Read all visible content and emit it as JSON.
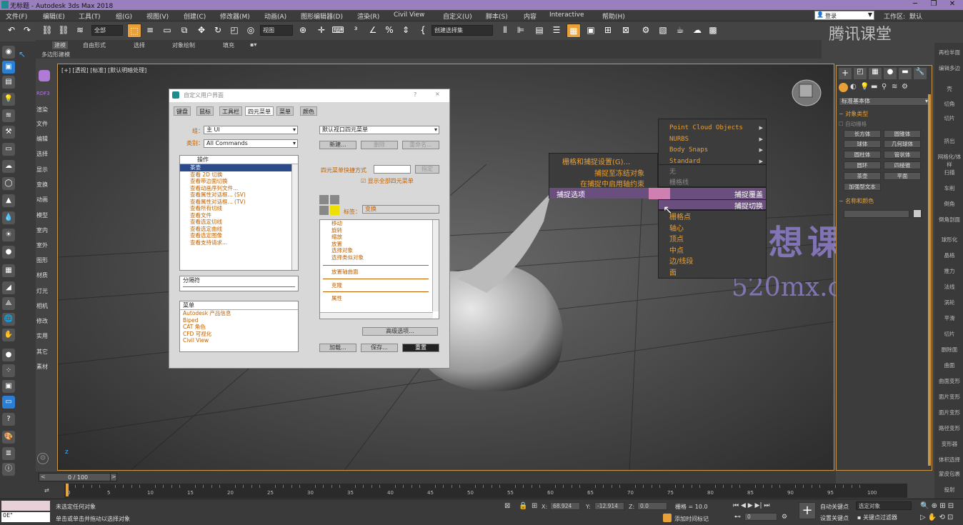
{
  "app": {
    "title": "无标题 - Autodesk 3ds Max 2018"
  },
  "menu": [
    "文件(F)",
    "编辑(E)",
    "工具(T)",
    "组(G)",
    "视图(V)",
    "创建(C)",
    "修改器(M)",
    "动画(A)",
    "图形编辑器(D)",
    "渲染(R)",
    "Civil View",
    "自定义(U)",
    "脚本(S)",
    "内容",
    "Interactive",
    "帮助(H)"
  ],
  "login": {
    "user": "登录",
    "workspace_label": "工作区:",
    "workspace": "默认"
  },
  "toolbar": {
    "filter": "全部",
    "refcoord": "视图",
    "selset": "创建选择集"
  },
  "ribbon": {
    "tabs": [
      "建模",
      "自由形式",
      "选择",
      "对象绘制",
      "填充"
    ],
    "sub": "多边形建模"
  },
  "left_labels": [
    "渲染",
    "文件",
    "编辑",
    "选择",
    "显示",
    "变换",
    "动画",
    "模型",
    "室内",
    "室外",
    "图形",
    "材质",
    "灯光",
    "相机",
    "修改",
    "实用",
    "其它",
    "素材"
  ],
  "rdf": "RDF3",
  "viewport": {
    "label": "[+] [透视] [标准] [默认明暗处理]"
  },
  "dialog": {
    "title": "自定义用户界面",
    "help": "?",
    "close": "×",
    "tabs": [
      "键盘",
      "鼠标",
      "工具栏",
      "四元菜单",
      "菜单",
      "颜色"
    ],
    "group_label": "组：",
    "group_value": "主 UI",
    "category_label": "类别：",
    "category_value": "All Commands",
    "actions_header": "操作",
    "actions": [
      "茶壶",
      "查看 2D 切换",
      "查看带边面切换",
      "查看动画序列文件...",
      "查看属性对话框... (SV)",
      "查看属性对话框... (TV)",
      "查看所有切线",
      "查看文件",
      "查看选定切线",
      "查看选定曲线",
      "查看选定图像",
      "查看支持请求..."
    ],
    "separator_label": "分隔符",
    "menu_list_header": "菜单",
    "menu_list": [
      "Autodesk 产品信息",
      "Biped",
      "CAT 角色",
      "CFD 可视化",
      "Civil View"
    ],
    "quad_select": "默认视口四元菜单",
    "btn_new": "新建...",
    "btn_delete": "删除",
    "btn_rename": "重命名...",
    "shortcut_label": "四元菜单快捷方式",
    "shortcut_btn": "指定",
    "show_all": "显示全部四元菜单",
    "tag_label": "标签：",
    "tag_value": "变换",
    "quad_items": [
      "移动",
      "旋转",
      "缩放",
      "放置",
      "选择对象",
      "选择类似对象"
    ],
    "quad_items2": [
      "放置轴曲面",
      "克隆",
      "属性"
    ],
    "btn_advanced": "高级选项...",
    "btn_load": "加载...",
    "btn_save": "保存...",
    "btn_reset": "重置"
  },
  "quad": {
    "left": [
      "栅格和捕捉设置(G)...",
      "捕捉至冻结对象",
      "在捕捉中启用轴约束",
      "捕捉选项"
    ],
    "right_top": [
      "Point Cloud Objects",
      "NURBS",
      "Body Snaps",
      "Standard"
    ],
    "right_mid": [
      "无",
      "栅格线"
    ],
    "hl1": "捕捉覆盖",
    "hl2": "捕捉切换",
    "right_bottom": [
      "栅格点",
      "轴心",
      "顶点",
      "中点",
      "边/线段",
      "面"
    ]
  },
  "watermarks": {
    "tencent": "腾讯课堂",
    "mengxiang": "梦想课堂",
    "url": "520mx.com"
  },
  "rightpanel": {
    "dropdown": "标准基本体",
    "objtype": "对象类型",
    "autogrid": "自动栅格",
    "buttons": [
      "长方体",
      "圆锥体",
      "球体",
      "几何球体",
      "圆柱体",
      "管状体",
      "圆环",
      "四棱锥",
      "茶壶",
      "平面"
    ],
    "extra": "加强型文本",
    "namecolor": "名称和颜色"
  },
  "farright": [
    "再检半面",
    "编辑多边",
    "壳",
    "切角",
    "切片",
    "挤出",
    "网格化/体样",
    "扫描",
    "车削",
    "倒角",
    "倒角剖面",
    "球形化",
    "晶格",
    "推力",
    "法线",
    "涡轮",
    "平滑",
    "切片",
    "删除面",
    "曲面",
    "曲面变形",
    "面片变形",
    "面片变形",
    "路径变形",
    "变形器",
    "体积选择",
    "蒙皮包裹",
    "投射",
    "融化"
  ],
  "timeline": {
    "frame": "0 / 100",
    "ticks": [
      "0",
      "5",
      "10",
      "15",
      "20",
      "25",
      "30",
      "35",
      "40",
      "45",
      "50",
      "55",
      "60",
      "65",
      "70",
      "75",
      "80",
      "85",
      "90",
      "95",
      "100"
    ]
  },
  "status": {
    "msg1": "未选定任何对象",
    "msg2": "单击或单击并拖动以选择对象",
    "maxscript": "0E\"",
    "x_label": "X:",
    "x": "68.924",
    "y_label": "Y:",
    "y": "-12.914",
    "z_label": "Z:",
    "z": "0.0",
    "grid": "栅格 = 10.0",
    "addtime": "添加时间标记",
    "autokey": "自动关键点",
    "setkey": "设置关键点",
    "keyfilter": "关键点过滤器",
    "selobj": "选定对象",
    "frame": "0"
  }
}
